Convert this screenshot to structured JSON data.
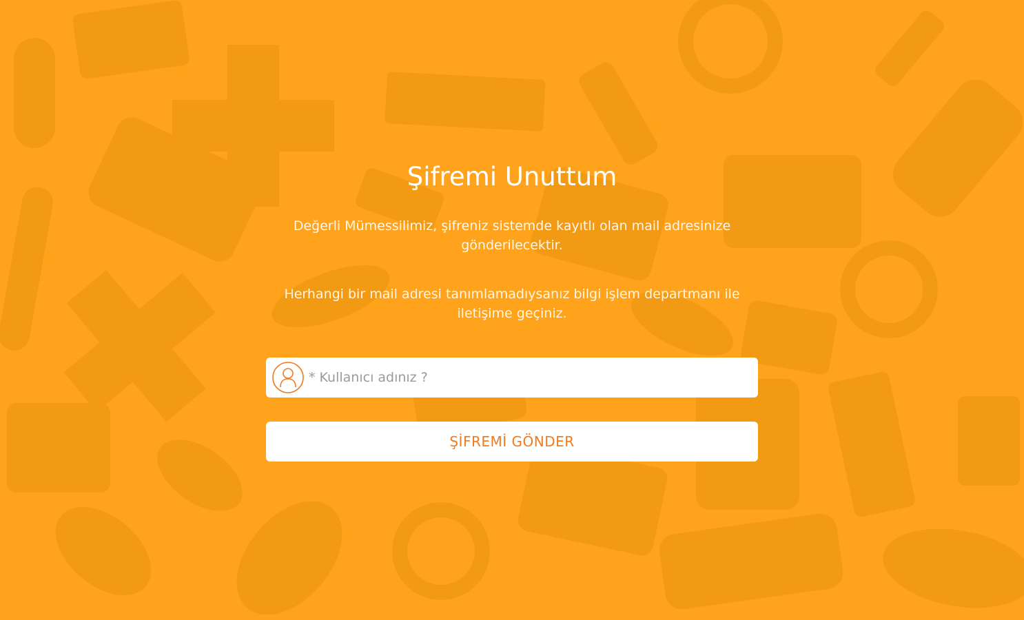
{
  "colors": {
    "background": "#ffa31c",
    "pattern": "#f39a14",
    "accent": "#f07b22",
    "text": "#ffffff"
  },
  "page": {
    "title": "Şifremi Unuttum",
    "description_1": "Değerli Mümessilimiz, şifreniz sistemde kayıtlı olan mail adresinize gönderilecektir.",
    "description_2": "Herhangi bir mail adresi tanımlamadıysanız bilgi işlem departmanı ile iletişime geçiniz."
  },
  "form": {
    "username": {
      "icon": "user-icon",
      "value": "",
      "placeholder": "* Kullanıcı adınız ?"
    },
    "submit_label": "ŞİFREMİ GÖNDER"
  }
}
